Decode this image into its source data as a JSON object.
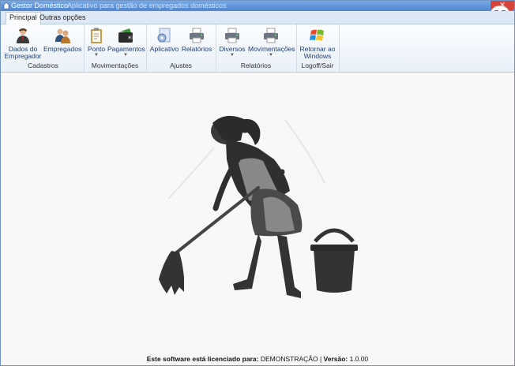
{
  "window": {
    "title": "Gestor Doméstico",
    "subtitle": "Aplicativo para gestão de empregados domésticos",
    "close_glyph": "✕"
  },
  "tabs": [
    {
      "label": "Principal"
    },
    {
      "label": "Outras opções"
    }
  ],
  "ribbon": {
    "groups": [
      {
        "label": "Cadastros",
        "buttons": [
          {
            "label": "Dados do Empregador",
            "icon": "person-icon"
          },
          {
            "label": "Empregados",
            "icon": "people-icon"
          }
        ]
      },
      {
        "label": "Movimentações",
        "buttons": [
          {
            "label": "Ponto",
            "icon": "clipboard-icon"
          },
          {
            "label": "Pagamentos",
            "icon": "wallet-icon"
          }
        ]
      },
      {
        "label": "Ajustes",
        "buttons": [
          {
            "label": "Aplicativo",
            "icon": "app-settings-icon"
          },
          {
            "label": "Relatórios",
            "icon": "printer-icon"
          }
        ]
      },
      {
        "label": "Relatórios",
        "buttons": [
          {
            "label": "Diversos",
            "icon": "printer-icon"
          },
          {
            "label": "Movimentações",
            "icon": "printer-icon"
          }
        ]
      },
      {
        "label": "Logoff/Sair",
        "buttons": [
          {
            "label": "Retornar ao Windows",
            "icon": "windows-icon"
          }
        ]
      }
    ]
  },
  "status": {
    "prefix": "Este software está licenciado para:",
    "licensee": "DEMONSTRAÇÃO",
    "separator": "|",
    "version_label": "Versão:",
    "version": "1.0.00"
  }
}
